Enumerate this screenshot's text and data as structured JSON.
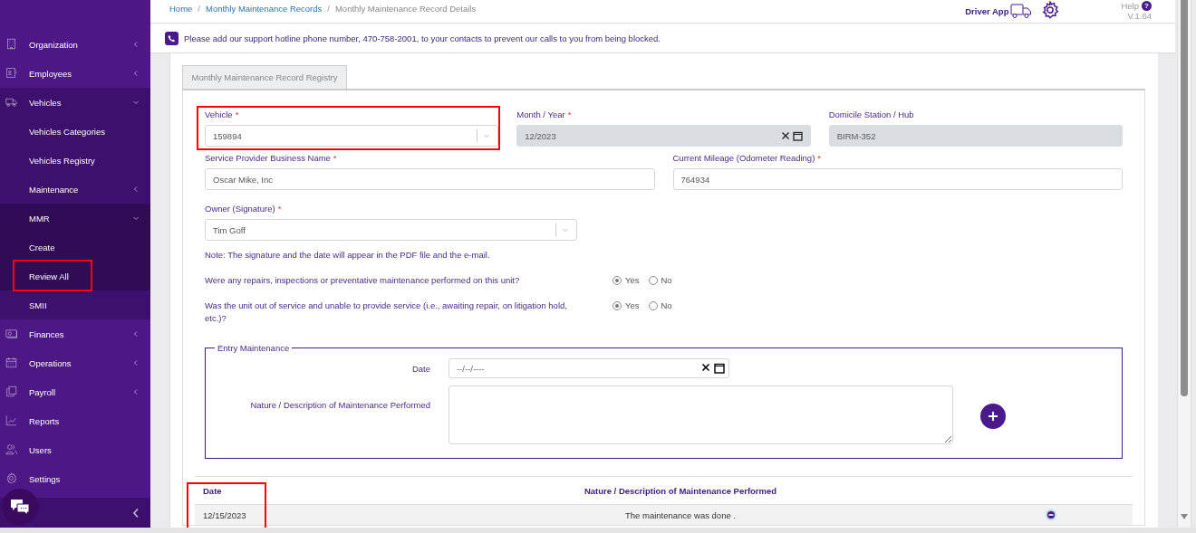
{
  "sidebar": {
    "items": [
      {
        "label": "Organization",
        "expanded": false,
        "highlighted": false
      },
      {
        "label": "Employees",
        "expanded": false,
        "highlighted": false
      },
      {
        "label": "Vehicles",
        "expanded": true,
        "highlighted": false,
        "children": [
          {
            "label": "Vehicles Categories",
            "highlighted": false
          },
          {
            "label": "Vehicles Registry",
            "highlighted": false
          },
          {
            "label": "Maintenance",
            "expanded": false,
            "highlighted": false
          },
          {
            "label": "MMR",
            "expanded": true,
            "highlighted": false,
            "children": [
              {
                "label": "Create",
                "highlighted": false
              },
              {
                "label": "Review All",
                "highlighted": true
              }
            ]
          },
          {
            "label": "SMII",
            "highlighted": false
          }
        ]
      },
      {
        "label": "Finances",
        "expanded": false,
        "highlighted": false
      },
      {
        "label": "Operations",
        "expanded": false,
        "highlighted": false
      },
      {
        "label": "Payroll",
        "expanded": false,
        "highlighted": false
      },
      {
        "label": "Reports",
        "highlighted": false
      },
      {
        "label": "Users",
        "highlighted": false
      },
      {
        "label": "Settings",
        "highlighted": false
      }
    ]
  },
  "header": {
    "breadcrumb": {
      "separator": "/",
      "items": [
        {
          "label": "Home",
          "current": false
        },
        {
          "label": "Monthly Maintenance Records",
          "current": false
        },
        {
          "label": "Monthly Maintenance Record Details",
          "current": true
        }
      ]
    },
    "driver_app": "Driver App",
    "help": "Help",
    "help_icon": "?",
    "version": "V.1.64"
  },
  "notice": {
    "text": "Please add our support hotline phone number, 470-758-2001, to your contacts to prevent our calls to you from being blocked."
  },
  "form": {
    "tabs": [
      {
        "label": "Monthly Maintenance Record Registry",
        "selected": true
      }
    ],
    "required_mark": "*",
    "field_rows": [
      [
        {
          "kind": "select",
          "label": "Vehicle",
          "required": true,
          "value": "159894",
          "highlighted": true
        },
        {
          "kind": "month",
          "label": "Month / Year",
          "required": true,
          "value": "12/2023",
          "disabled": true
        },
        {
          "kind": "text",
          "label": "Domicile Station / Hub",
          "required": false,
          "value": "BIRM-352",
          "disabled": true
        }
      ],
      [
        {
          "kind": "text",
          "label": "Service Provider Business Name",
          "required": true,
          "value": "Oscar Mike, Inc",
          "disabled": false
        },
        {
          "kind": "text",
          "label": "Current Mileage (Odometer Reading)",
          "required": true,
          "value": "764934",
          "disabled": false
        }
      ],
      [
        {
          "kind": "select",
          "label": "Owner (Signature)",
          "required": true,
          "value": "Tim Goff",
          "highlighted": false
        }
      ]
    ],
    "note": "Note: The signature and the date will appear in the PDF file and the e-mail.",
    "questions": [
      {
        "text": "Were any repairs, inspections or preventative maintenance performed on this unit?",
        "options": [
          {
            "label": "Yes",
            "selected": true
          },
          {
            "label": "No",
            "selected": false
          }
        ]
      },
      {
        "text": "Was the unit out of service and unable to provide service (i.e., awaiting repair, on litigation hold, etc.)?",
        "options": [
          {
            "label": "Yes",
            "selected": true
          },
          {
            "label": "No",
            "selected": false
          }
        ]
      }
    ],
    "entry": {
      "legend": "Entry Maintenance",
      "date_label": "Date",
      "date_placeholder": "--/--/----",
      "description_label": "Nature / Description of Maintenance Performed"
    },
    "table": {
      "columns": [
        {
          "label": "Date",
          "highlighted": true
        },
        {
          "label": "Nature / Description of Maintenance Performed",
          "highlighted": false
        }
      ],
      "rows": [
        {
          "cells": [
            "12/15/2023",
            "The maintenance was done ."
          ]
        }
      ]
    }
  }
}
